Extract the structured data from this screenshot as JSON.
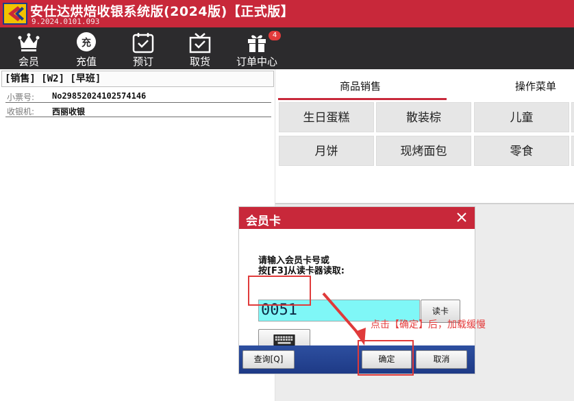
{
  "app": {
    "title": "安仕达烘焙收银系统版(2024版)【正式版】",
    "version": "9.2024.0101.093"
  },
  "toolbar": {
    "items": [
      {
        "label": "会员",
        "icon": "crown-icon"
      },
      {
        "label": "充值",
        "icon": "recharge-icon",
        "icon_text": "充"
      },
      {
        "label": "预订",
        "icon": "calendar-check-icon"
      },
      {
        "label": "取货",
        "icon": "gift-box-check-icon"
      },
      {
        "label": "订单中心",
        "icon": "gift-icon",
        "badge": "4"
      }
    ]
  },
  "sale_panel": {
    "header": "[销售] [W2] [早班]",
    "receipt_label": "小票号:",
    "receipt_value": "No29852024102574146",
    "register_label": "收银机:",
    "register_value": "西丽收银"
  },
  "right_panel": {
    "tabs": [
      {
        "label": "商品销售",
        "active": true
      },
      {
        "label": "操作菜单",
        "active": false
      }
    ],
    "categories": [
      "生日蛋糕",
      "散装棕",
      "儿童",
      "月饼",
      "现烤面包",
      "零食"
    ]
  },
  "dialog": {
    "title": "会员卡",
    "prompt_line1": "请输入会员卡号或",
    "prompt_line2": "按[F3]从读卡器读取:",
    "card_value": "0051",
    "read_card_label": "读卡",
    "query_label": "查询[Q]",
    "confirm_label": "确定",
    "cancel_label": "取消"
  },
  "annotation": {
    "note": "点击【确定】后，加载缓慢",
    "color": "#e03a3a"
  },
  "colors": {
    "brand_red": "#c8283a",
    "toolbar_dark": "#2c2b2d",
    "input_cyan": "#7ff7f7",
    "footer_blue": "#1e3a86"
  }
}
